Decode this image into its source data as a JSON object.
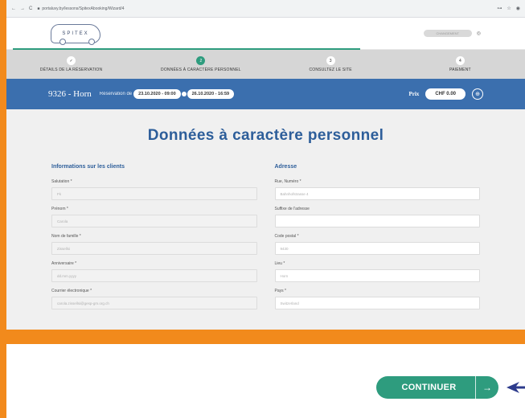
{
  "browser": {
    "nav": [
      "←",
      "→",
      "C"
    ],
    "url": "portaluvy.by/lessons/SpitexAbooking/Wizard/4",
    "right_icons": [
      "⊶",
      "☆",
      "◉"
    ]
  },
  "header": {
    "logo_text": "SPITEX",
    "lang_pill": "CHANGEMENT",
    "user_icon": "◎"
  },
  "steps": [
    {
      "num": "✓",
      "label": "DÉTAILS DE LA RÉSERVATION",
      "active": false
    },
    {
      "num": "2",
      "label": "DONNÉES À CARACTÈRE PERSONNEL",
      "active": true
    },
    {
      "num": "3",
      "label": "CONSULTEZ LE SITE",
      "active": false
    },
    {
      "num": "4",
      "label": "PAIEMENT",
      "active": false
    }
  ],
  "booking": {
    "id": "9326 - Horn",
    "res_label": "Réservation de",
    "date_from": "23.10.2020 - 09:00",
    "date_to": "26.10.2020 - 16:59",
    "prix_label": "Prix",
    "price": "CHF 0.00",
    "cart_icon": "⊕"
  },
  "page_title": "Données à caractère personnel",
  "clients": {
    "heading": "Informations sur les clients",
    "fields": [
      {
        "label": "Salutation *",
        "value": "Fk"
      },
      {
        "label": "Prénom *",
        "value": "Carola"
      },
      {
        "label": "Nom de famille *",
        "value": "Zissellsi"
      },
      {
        "label": "Anniversaire *",
        "value": "dd.mm.yyyy"
      },
      {
        "label": "Courrier électronique *",
        "value": "carola.zissellsi@gesp-gm.org.ch"
      }
    ]
  },
  "address": {
    "heading": "Adresse",
    "fields": [
      {
        "label": "Rue, Numéro *",
        "value": "Bahnhofstrasse 4"
      },
      {
        "label": "Suffixe de l'adresse",
        "value": ""
      },
      {
        "label": "Code postal *",
        "value": "9430"
      },
      {
        "label": "Lieu *",
        "value": "Horn"
      },
      {
        "label": "Pays *",
        "value": "Switzerland"
      }
    ]
  },
  "footer": {
    "continue_label": "CONTINUER",
    "continue_icon": "→"
  }
}
